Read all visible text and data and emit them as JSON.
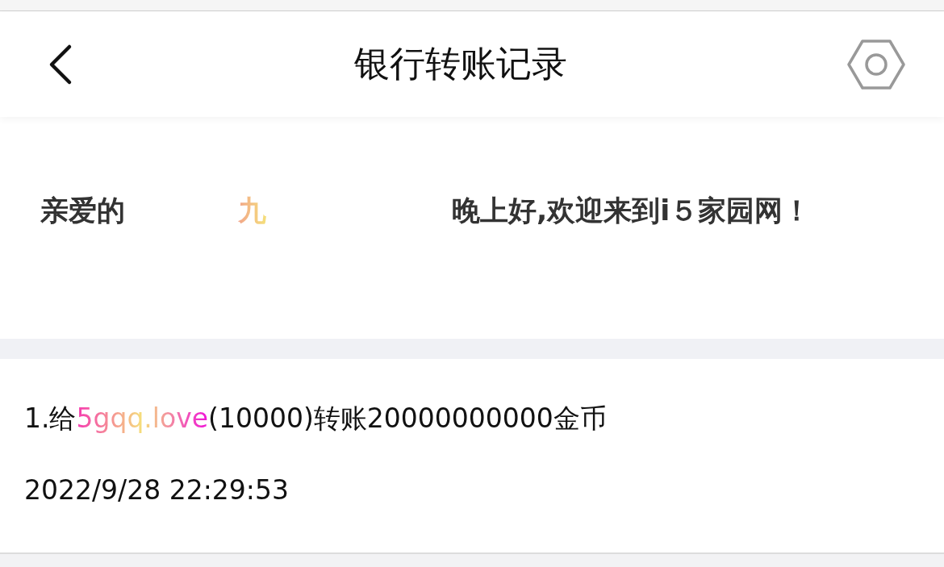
{
  "header": {
    "title": "银行转账记录"
  },
  "greeting": {
    "prefix": "亲爱的",
    "username": "九",
    "suffix": "晚上好,欢迎来到i５家园网！"
  },
  "records": [
    {
      "prefix": "1.给",
      "recipient": "5gqq.love",
      "suffix": "(10000)转账20000000000金币",
      "time": "2022/9/28 22:29:53"
    }
  ]
}
